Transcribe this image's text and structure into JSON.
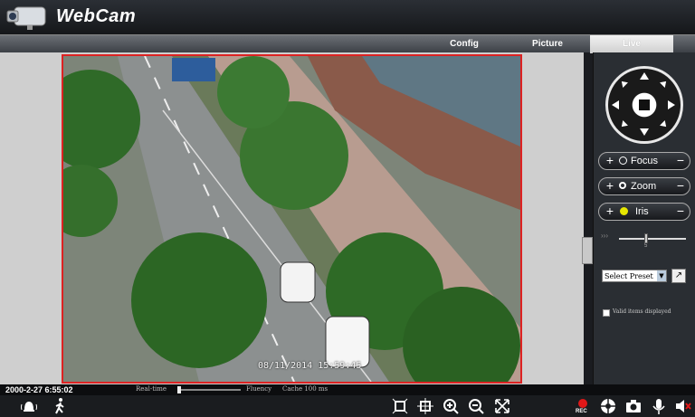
{
  "header": {
    "title": "WebCam"
  },
  "tabs": [
    {
      "label": "Config",
      "active": false
    },
    {
      "label": "Picture",
      "active": false
    },
    {
      "label": "Live",
      "active": true
    }
  ],
  "video": {
    "osd_timestamp": "08/11/2014 15:59:45"
  },
  "panel": {
    "focus_label": "Focus",
    "zoom_label": "Zoom",
    "iris_label": "Iris",
    "plus": "+",
    "minus": "−",
    "speed_value": "5",
    "preset_value": "Select Preset",
    "osd_checkbox_label": "Valid items displayed"
  },
  "status": {
    "clock": "2000-2-27 6:55:02",
    "realtime_label": "Real-time",
    "fluency_label": "Fluency",
    "cache_label": "Cache 100 ms",
    "rec_label": "REC"
  },
  "icons": [
    "webcam-logo-icon",
    "alarm-bell-icon",
    "walking-person-icon",
    "fit-screen-icon",
    "center-target-icon",
    "zoom-in-icon",
    "zoom-out-icon",
    "fullscreen-icon",
    "record-icon",
    "color-wheel-icon",
    "camera-snapshot-icon",
    "microphone-icon",
    "speaker-mute-icon"
  ],
  "colors": {
    "accent_red": "#d22222",
    "panel": "#2a2e33",
    "header": "#15171a"
  }
}
